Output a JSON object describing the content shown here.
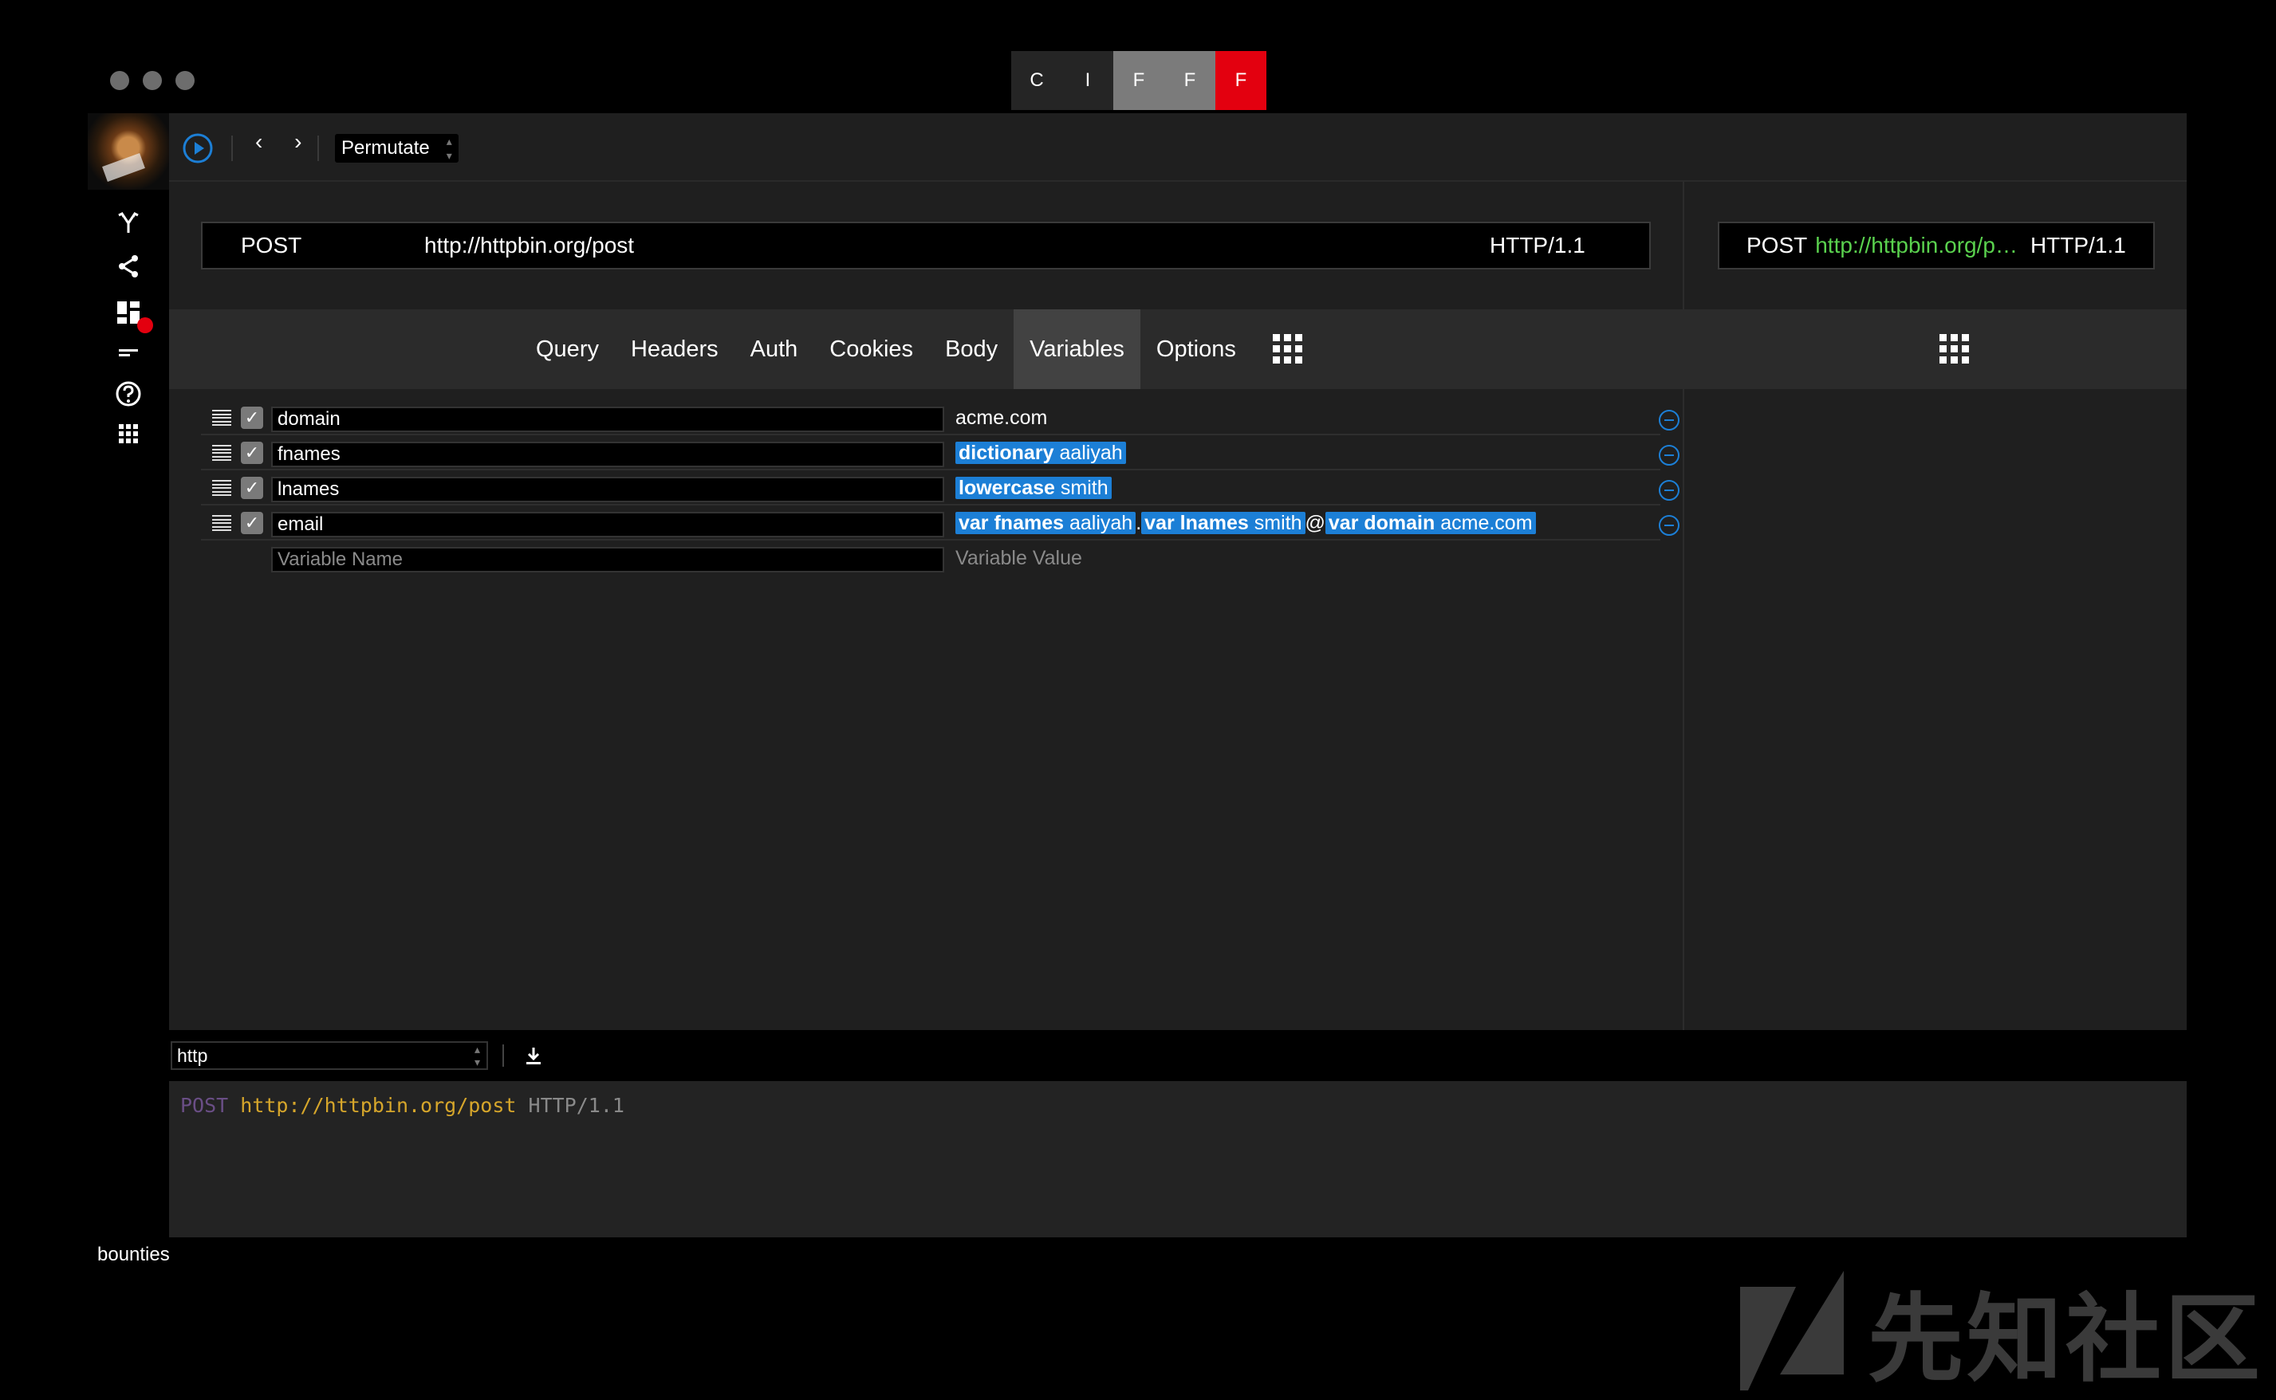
{
  "window": {
    "segments": [
      "C",
      "I",
      "F",
      "F",
      "F"
    ]
  },
  "sidebar": {
    "icons": [
      "branch-icon",
      "share-icon",
      "dashboard-icon",
      "menu-lines-icon",
      "help-icon",
      "grid-icon"
    ],
    "label": "bounties"
  },
  "toolbar": {
    "nav_arrows": "‹ ›",
    "mode": "Permutate"
  },
  "request": {
    "method": "POST",
    "url": "http://httpbin.org/post",
    "protocol": "HTTP/1.1"
  },
  "preview": {
    "method": "POST",
    "url": "http://httpbin.org/p…",
    "protocol": "HTTP/1.1"
  },
  "tabs": [
    "Query",
    "Headers",
    "Auth",
    "Cookies",
    "Body",
    "Variables",
    "Options"
  ],
  "active_tab": "Variables",
  "variables": [
    {
      "name": "domain",
      "enabled": true,
      "value_text": "acme.com"
    },
    {
      "name": "fnames",
      "enabled": true,
      "token_kw": "dictionary",
      "token_val": "aaliyah"
    },
    {
      "name": "lnames",
      "enabled": true,
      "token_kw": "lowercase",
      "token_val": "smith"
    },
    {
      "name": "email",
      "enabled": true,
      "t1_kw": "var fnames",
      "t1_val": "aaliyah",
      "sep1": ".",
      "t2_kw": "var lnames",
      "t2_val": "smith",
      "sep2": "@",
      "t3_kw": "var domain",
      "t3_val": "acme.com"
    }
  ],
  "new_variable": {
    "name_placeholder": "Variable Name",
    "value_placeholder": "Variable Value"
  },
  "output": {
    "format": "http",
    "method": "POST",
    "url": "http://httpbin.org/post",
    "protocol": "HTTP/1.1"
  },
  "colors": {
    "accent_blue": "#1c7fd6",
    "red": "#e3000f",
    "url_green": "#5ad14e"
  },
  "watermark": "先知社区"
}
